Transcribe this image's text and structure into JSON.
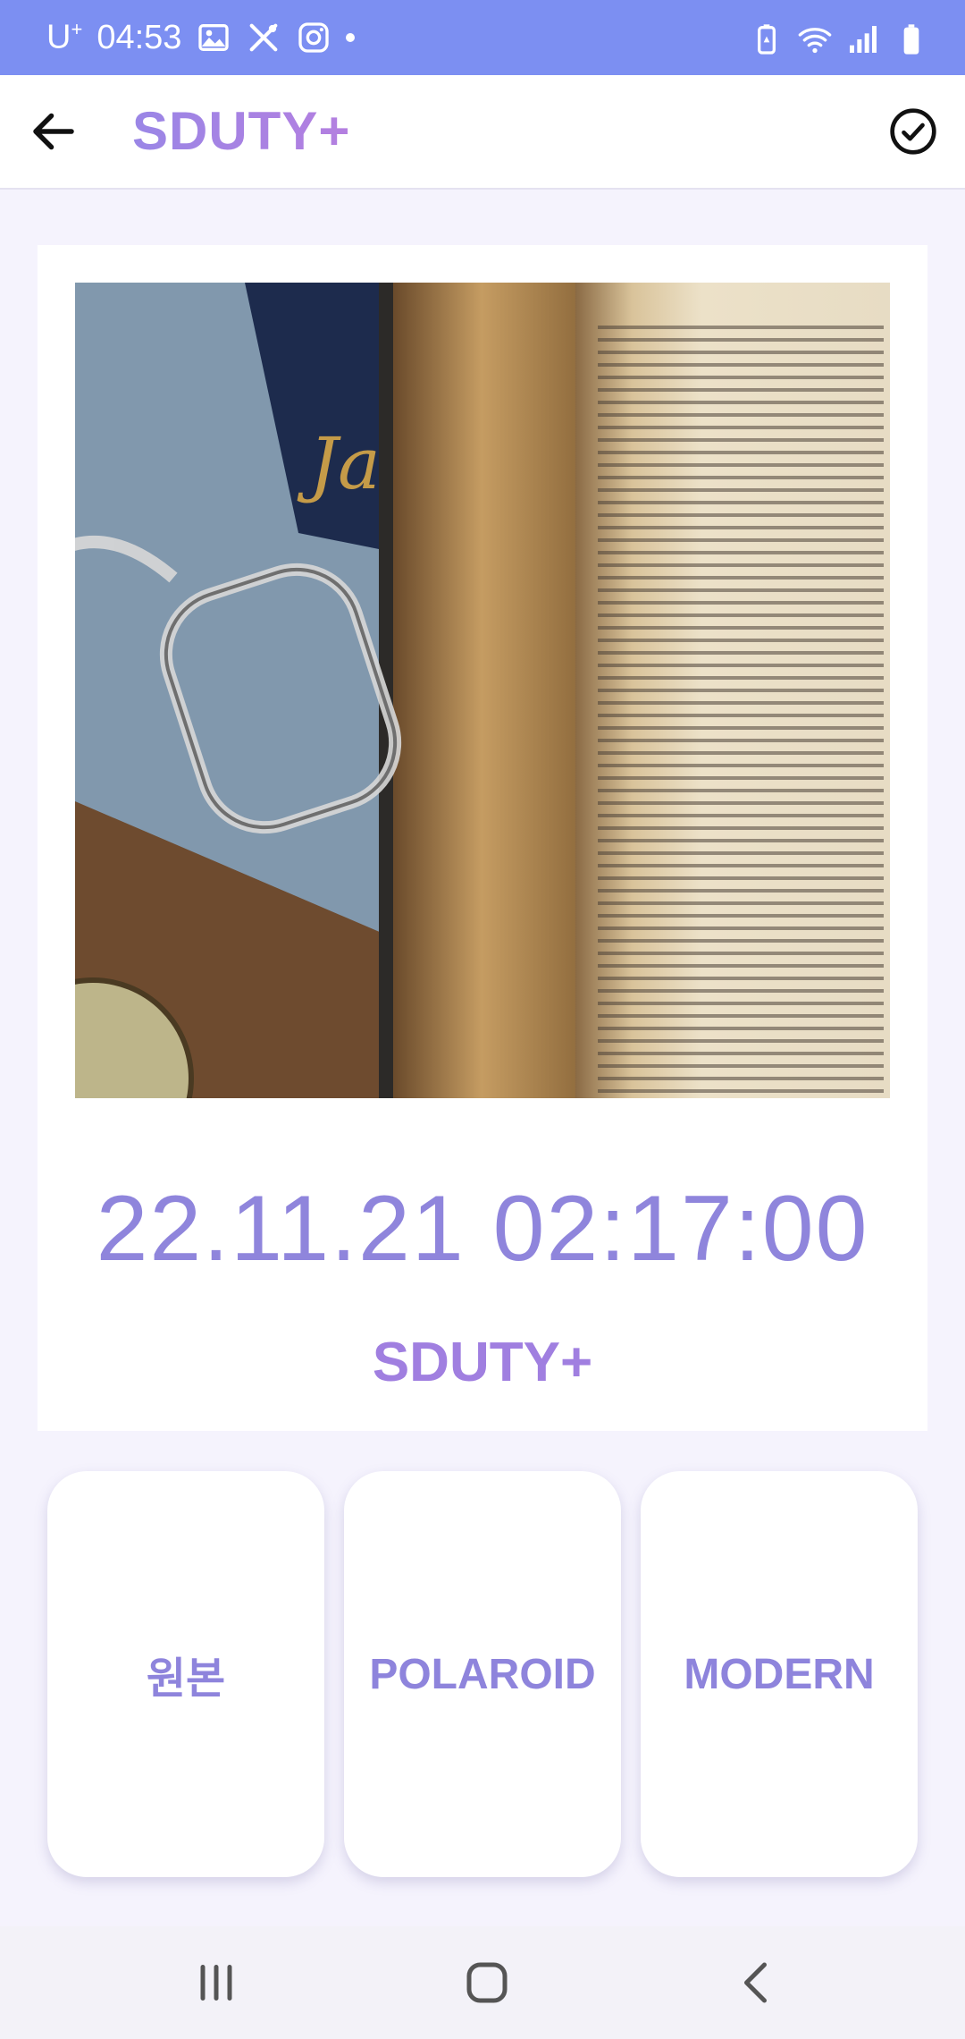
{
  "status_bar": {
    "carrier": "U",
    "carrier_sup": "+",
    "time": "04:53",
    "icons": [
      "image-icon",
      "tools-icon",
      "instagram-icon",
      "dot-icon"
    ],
    "right_icons": [
      "battery-saver-icon",
      "wifi-icon",
      "signal-icon",
      "battery-icon"
    ],
    "background": "#7c8ff2"
  },
  "app_bar": {
    "title": "SDUTY+",
    "back_icon": "arrow-left-icon",
    "confirm_icon": "check-circle-icon"
  },
  "card": {
    "timestamp": "22.11.21 02:17:00",
    "brand": "SDUTY+"
  },
  "filters": [
    {
      "label": "원본"
    },
    {
      "label": "POLAROID"
    },
    {
      "label": "MODERN"
    }
  ],
  "nav_bar": {
    "icons": [
      "recent-apps-icon",
      "home-icon",
      "back-icon"
    ]
  },
  "colors": {
    "accent": "#8e84dc",
    "title_gradient_start": "#9a86e6",
    "title_gradient_end": "#b47fe0",
    "page_bg": "#f5f3fd"
  }
}
